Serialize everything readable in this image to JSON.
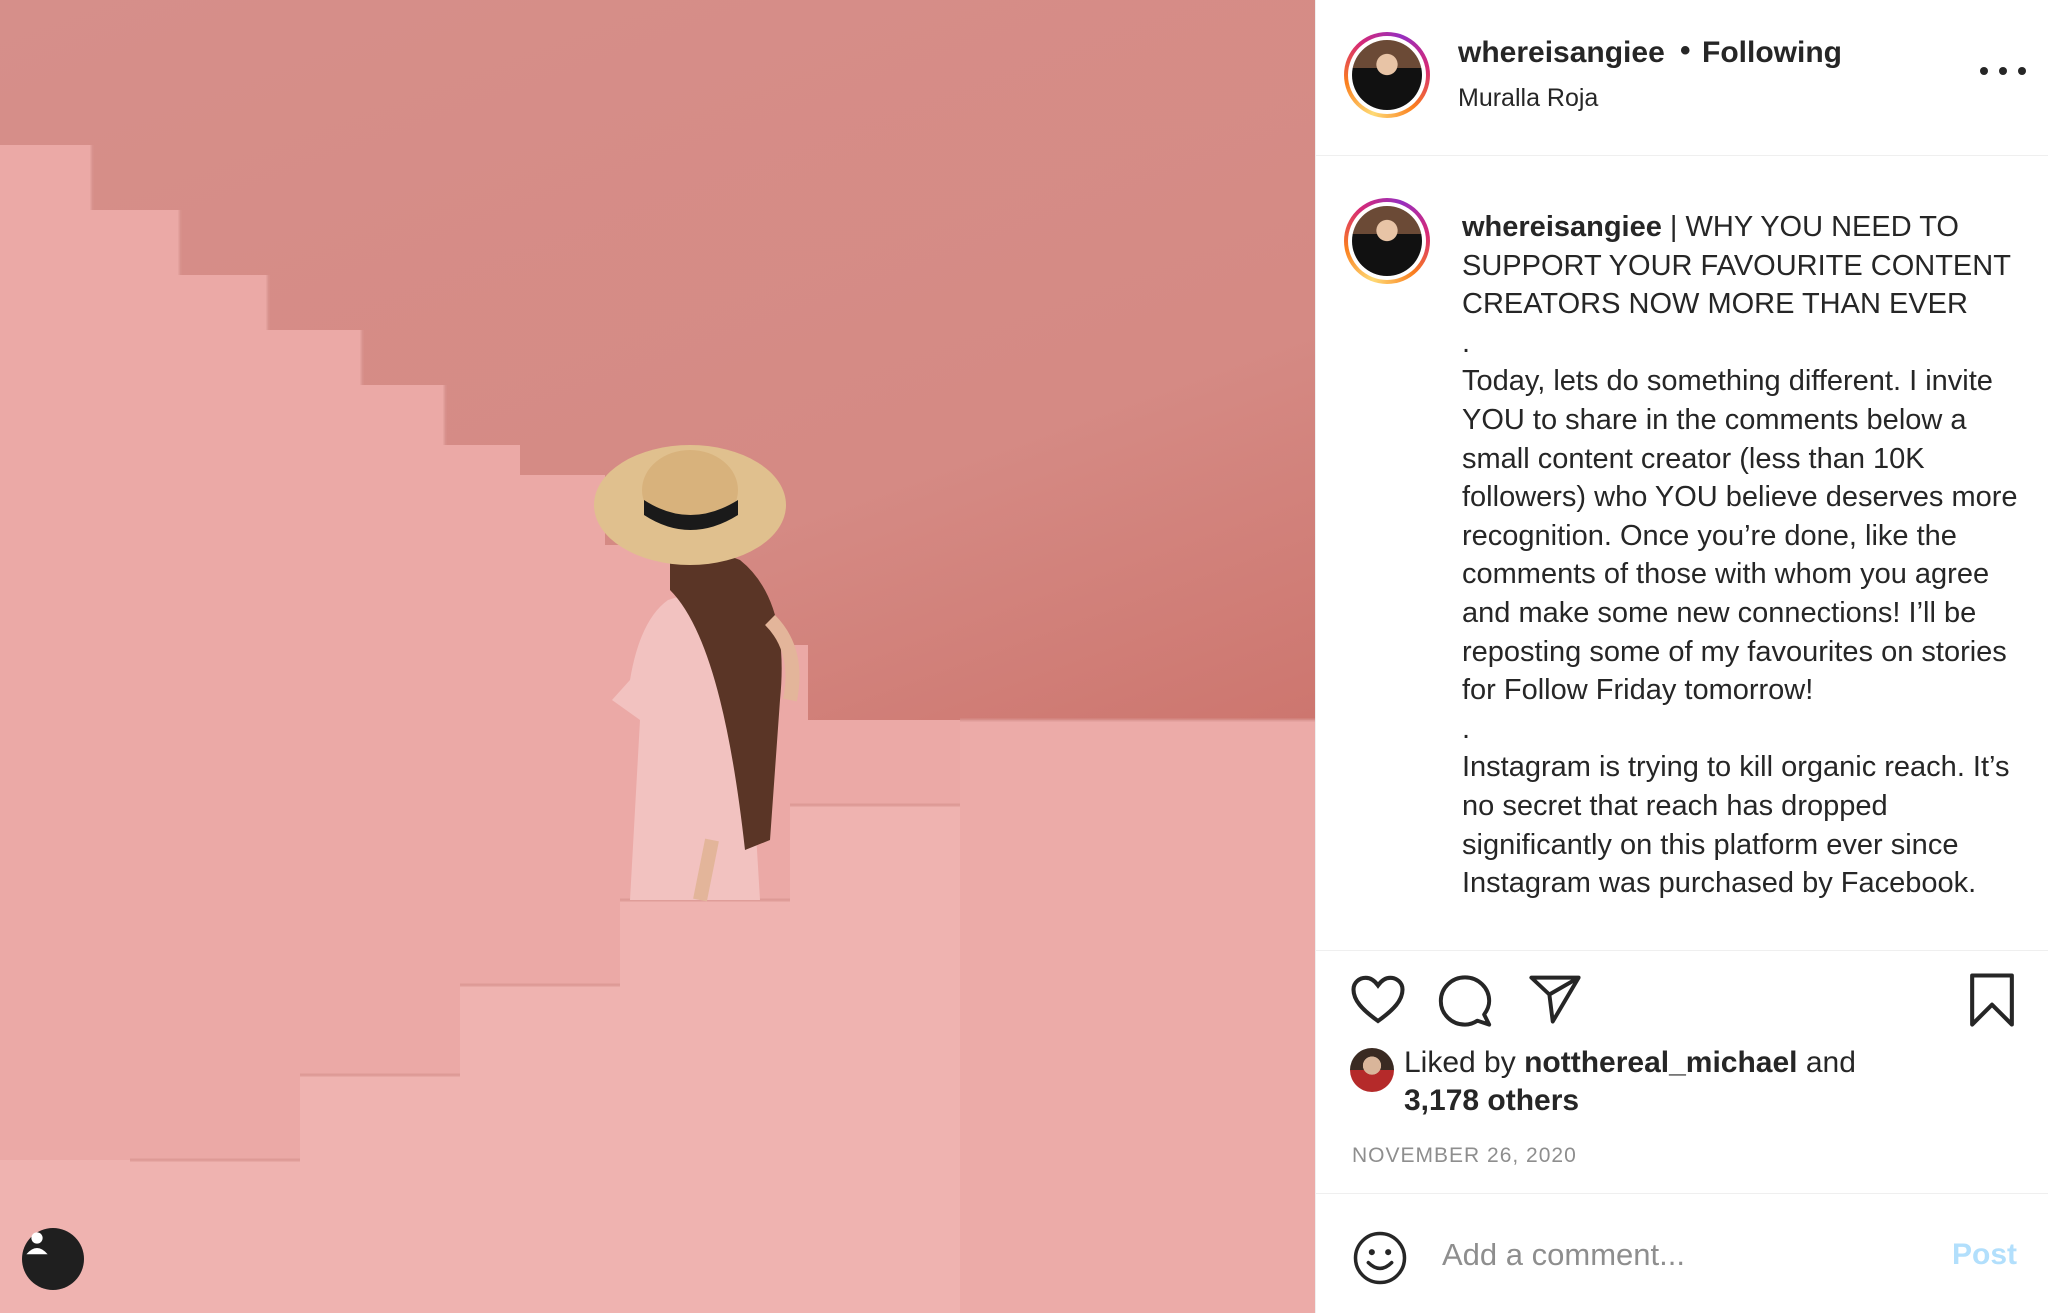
{
  "post": {
    "username": "whereisangiee",
    "follow_status": "Following",
    "separator": "•",
    "location": "Muralla Roja"
  },
  "caption": {
    "username": "whereisangiee",
    "headline": " | WHY YOU NEED TO SUPPORT YOUR FAVOURITE CONTENT CREATORS NOW MORE THAN EVER",
    "dot1": ".",
    "paragraph1": "Today, lets do something different. I invite YOU to share in the comments below a small content creator (less than 10K followers) who YOU believe deserves more recognition. Once you’re done, like the comments of those with whom you agree and make some new connections! I’ll be reposting some of my favourites on stories for Follow Friday tomorrow!",
    "dot2": ".",
    "paragraph2": "Instagram is trying to kill organic reach. It’s no secret that reach has dropped significantly on this platform ever since Instagram was purchased by Facebook."
  },
  "likes": {
    "prefix": "Liked by ",
    "liker": "notthereal_michael",
    "conj": " and",
    "others": "3,178 others"
  },
  "date": "NOVEMBER 26, 2020",
  "comment": {
    "placeholder": "Add a comment...",
    "post_label": "Post"
  },
  "icons": {
    "like": "heart-icon",
    "comment": "comment-icon",
    "share": "paper-plane-icon",
    "save": "bookmark-icon",
    "emoji": "smiley-icon",
    "more": "more-dots-icon",
    "user_tag": "user-icon"
  },
  "colors": {
    "post_button_disabled": "#b2dffc",
    "muted_text": "#8e8e8e",
    "photo_wall": "#d58a84"
  }
}
